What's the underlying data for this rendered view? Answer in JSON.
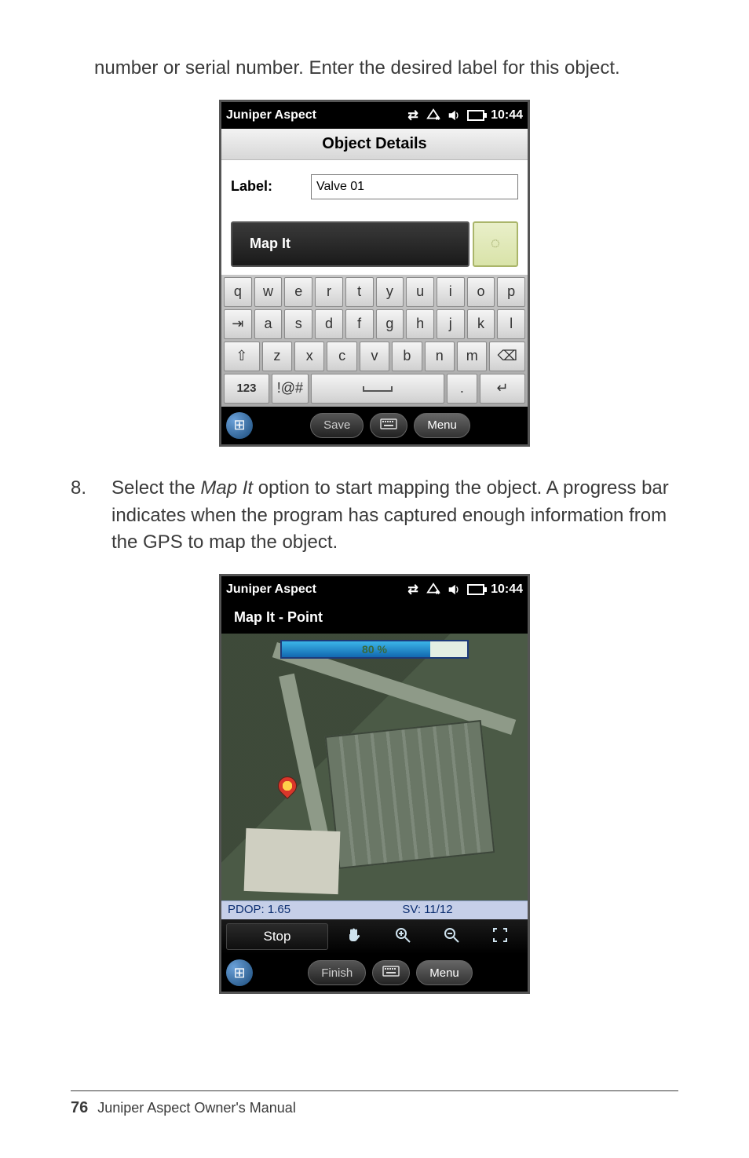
{
  "paragraphs": {
    "intro": "number or serial number. Enter the desired label for this object.",
    "step8_num": "8.",
    "step8_body_a": "Select the ",
    "step8_body_italic": "Map It",
    "step8_body_b": " option to start mapping the object. A progress bar indicates when the program has captured enough information from the GPS to map the object."
  },
  "device1": {
    "status": {
      "app": "Juniper Aspect",
      "time": "10:44"
    },
    "title": "Object Details",
    "form": {
      "label_text": "Label:",
      "input_value": "Valve 01",
      "mapit_label": "Map It"
    },
    "keyboard": {
      "row1": [
        "q",
        "w",
        "e",
        "r",
        "t",
        "y",
        "u",
        "i",
        "o",
        "p"
      ],
      "row2_tab": "⇥",
      "row2": [
        "a",
        "s",
        "d",
        "f",
        "g",
        "h",
        "j",
        "k",
        "l"
      ],
      "row3_shift": "⇧",
      "row3": [
        "z",
        "x",
        "c",
        "v",
        "b",
        "n",
        "m"
      ],
      "row3_back": "⌫",
      "row4_123": "123",
      "row4_sym": "!@#",
      "row4_space": " ",
      "row4_dot": ".",
      "row4_enter": "↵"
    },
    "bottombar": {
      "save": "Save",
      "menu": "Menu"
    }
  },
  "device2": {
    "status": {
      "app": "Juniper Aspect",
      "time": "10:44"
    },
    "title": "Map It - Point",
    "progress": {
      "percent": 80,
      "label": "80 %"
    },
    "gps": {
      "pdop_label": "PDOP: 1.65",
      "sv_label": "SV: 11/12"
    },
    "toolbar": {
      "stop": "Stop"
    },
    "bottombar": {
      "finish": "Finish",
      "menu": "Menu"
    }
  },
  "footer": {
    "page": "76",
    "title": "Juniper Aspect Owner's Manual"
  }
}
